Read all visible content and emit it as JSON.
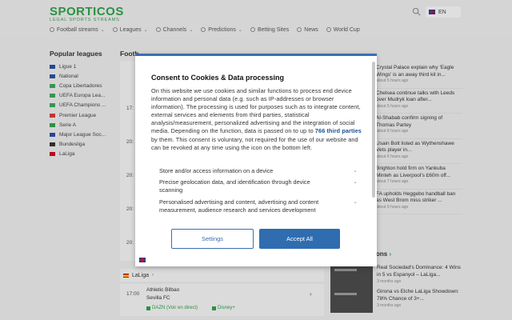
{
  "header": {
    "logo": "SPORTICOS",
    "tagline": "LEGAL SPORTS STREAMS",
    "language": "EN"
  },
  "nav": [
    {
      "label": "Football streams",
      "icon": "ball-icon",
      "chevron": true
    },
    {
      "label": "Leagues",
      "icon": "trophy-icon",
      "chevron": true
    },
    {
      "label": "Channels",
      "icon": "tv-icon",
      "chevron": true
    },
    {
      "label": "Predictions",
      "icon": "chart-icon",
      "chevron": true
    },
    {
      "label": "Betting Sites",
      "icon": "target-icon",
      "chevron": false
    },
    {
      "label": "News",
      "icon": "news-icon",
      "chevron": false
    },
    {
      "label": "World Cup",
      "icon": "trophy-icon",
      "chevron": false
    }
  ],
  "sidebar": {
    "title": "Popular leagues",
    "leagues": [
      {
        "label": "Ligue 1",
        "color": "#2b4ea0"
      },
      {
        "label": "National",
        "color": "#2b4ea0"
      },
      {
        "label": "Copa Libertadores",
        "color": "#3aa35a"
      },
      {
        "label": "UEFA Europa Lea...",
        "color": "#3aa35a"
      },
      {
        "label": "UEFA Champions ...",
        "color": "#3aa35a"
      },
      {
        "label": "Premier League",
        "color": "#d23a3a"
      },
      {
        "label": "Serie A",
        "color": "#2f9e4a"
      },
      {
        "label": "Major League Soc...",
        "color": "#2b4ea0"
      },
      {
        "label": "Bundesliga",
        "color": "#333333"
      },
      {
        "label": "LaLiga",
        "color": "#c60b1e"
      }
    ]
  },
  "center": {
    "title": "Footb",
    "times": [
      "17:",
      "20:",
      "20:",
      "20:",
      "20:"
    ],
    "laliga": {
      "label": "LaLiga",
      "match": {
        "time": "17:00",
        "home": "Athletic Bilbao",
        "away": "Sevilla FC",
        "channels": [
          "DAZN (Voir en direct)",
          "Disney+"
        ]
      }
    }
  },
  "news": [
    {
      "title": "Crystal Palace explain why 'Eagle Wings' is an away third kit in...",
      "time": "about 5 hours ago"
    },
    {
      "title": "Chelsea continue talks with Leeds over Mudryk loan after...",
      "time": "about 5 hours ago"
    },
    {
      "title": "Al-Shabab confirm signing of Thomas Partey",
      "time": "about 6 hours ago"
    },
    {
      "title": "Usain Bolt listed as Wythenshawe Vets player in...",
      "time": "about 6 hours ago"
    },
    {
      "title": "Brighton hold firm on Yankuba Minteh as Liverpool's £60m off...",
      "time": "about 7 hours ago"
    },
    {
      "title": "FA upholds Heggebo handball ban as West Brom miss striker ...",
      "time": "about 9 hours ago"
    }
  ],
  "predictions_section": {
    "title": "ons",
    "items": [
      {
        "title": "Real Sociedad's Dominance: 4 Wins in 5 vs Espanyol – LaLiga...",
        "time": "3 months ago"
      },
      {
        "title": "Girona vs Elche LaLiga Showdown: 78% Chance of 3+...",
        "time": "3 months ago"
      }
    ]
  },
  "consent": {
    "title": "Consent to Cookies & Data processing",
    "body_pre": "On this website we use cookies and similar functions to process end device information and personal data (e.g. such as IP-addresses or browser information). The processing is used for purposes such as to integrate content, external services and elements from third parties, statistical analysis/measurement, personalized advertising and the integration of social media. Depending on the function, data is passed on to up to ",
    "third_parties": "766 third parties",
    "body_post": " by them. This consent is voluntary, not required for the use of our website and can be revoked at any time using the icon on the bottom left.",
    "purposes": [
      "Store and/or access information on a device",
      "Precise geolocation data, and identification through device scanning",
      "Personalised advertising and content, advertising and content measurement, audience research and services development"
    ],
    "settings_label": "Settings",
    "accept_label": "Accept All"
  }
}
